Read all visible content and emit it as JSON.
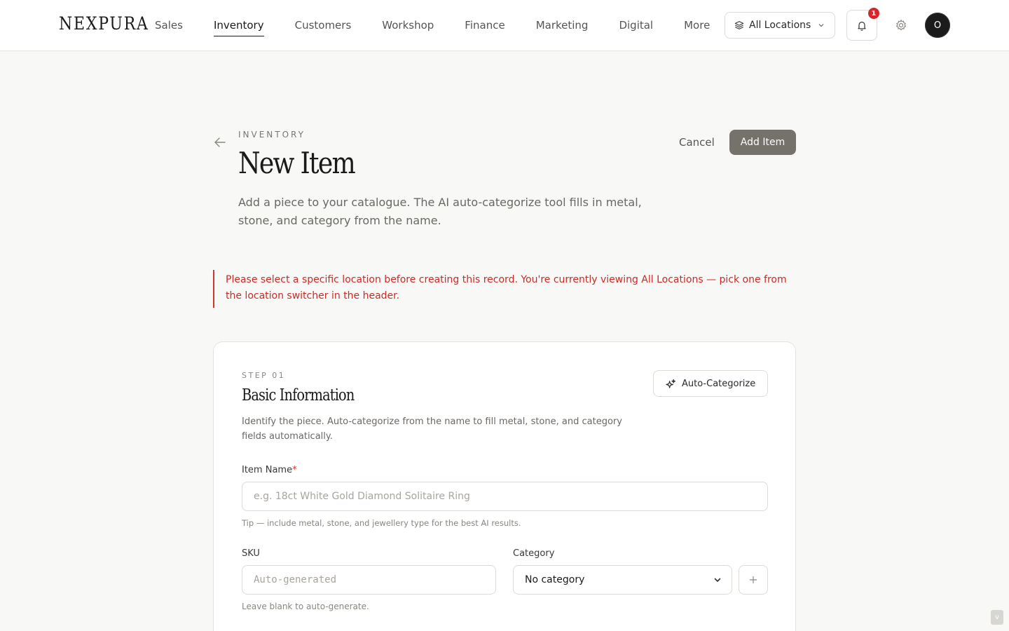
{
  "header": {
    "logo": "NEXPURA",
    "nav": [
      {
        "label": "Sales",
        "active": false
      },
      {
        "label": "Inventory",
        "active": true
      },
      {
        "label": "Customers",
        "active": false
      },
      {
        "label": "Workshop",
        "active": false
      },
      {
        "label": "Finance",
        "active": false
      },
      {
        "label": "Marketing",
        "active": false
      },
      {
        "label": "Digital",
        "active": false
      },
      {
        "label": "More",
        "active": false
      }
    ],
    "location_switcher": {
      "label": "All Locations",
      "icon": "layers-icon"
    },
    "notifications": {
      "count": "1",
      "icon": "bell-icon"
    },
    "settings_icon": "gear-icon",
    "avatar_initial": "O"
  },
  "page": {
    "eyebrow": "INVENTORY",
    "title": "New Item",
    "description": "Add a piece to your catalogue. The AI auto-categorize tool fills in metal, stone, and category from the name.",
    "cancel_label": "Cancel",
    "add_label": "Add Item"
  },
  "alert": {
    "text": "Please select a specific location before creating this record. You're currently viewing All Locations — pick one from the location switcher in the header.",
    "color": "#cc2a25"
  },
  "card": {
    "step": "STEP 01",
    "title": "Basic Information",
    "description": "Identify the piece. Auto-categorize from the name to fill metal, stone, and category fields automatically.",
    "auto_label": "Auto-Categorize",
    "item_name": {
      "label": "Item Name",
      "required_mark": "*",
      "value": "",
      "placeholder": "e.g. 18ct White Gold Diamond Solitaire Ring",
      "hint": "Tip — include metal, stone, and jewellery type for the best AI results."
    },
    "sku": {
      "label": "SKU",
      "value": "",
      "placeholder": "Auto-generated",
      "hint": "Leave blank to auto-generate."
    },
    "category": {
      "label": "Category",
      "selected": "No category"
    }
  },
  "colors": {
    "accent_button": "#75716b",
    "error": "#d0352f",
    "badge": "#d6252b"
  },
  "scroll_indicator": "v"
}
